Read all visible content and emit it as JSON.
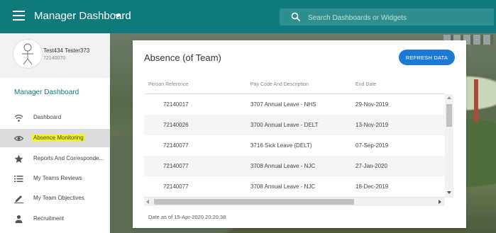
{
  "header": {
    "title": "Manager Dashboard",
    "search_placeholder": "Search Dashboards or Widgets",
    "search_value": ""
  },
  "profile": {
    "name": "Test434 Tester373",
    "id": "72140070"
  },
  "sidebar": {
    "section_title": "Manager Dashboard",
    "items": [
      {
        "label": "Dashboard",
        "icon": "wifi-icon"
      },
      {
        "label": "Absence Monitoring",
        "icon": "eye-icon",
        "active": true
      },
      {
        "label": "Reports And Corresponde...",
        "icon": "star-icon"
      },
      {
        "label": "My Teams Reviews",
        "icon": "list-icon"
      },
      {
        "label": "My Team Objectives",
        "icon": "pencil-icon"
      },
      {
        "label": "Recruitment",
        "icon": "person-icon"
      }
    ]
  },
  "card": {
    "title": "Absence (of Team)",
    "refresh_label": "REFRESH DATA",
    "columns": [
      "Person Reference",
      "Pay Code And Description",
      "End Date"
    ],
    "rows": [
      [
        "72140017",
        "3707 Annual Leave - NHS",
        "29-Nov-2019"
      ],
      [
        "72140026",
        "3700 Annual Leave - DELT",
        "13-Nov-2019"
      ],
      [
        "72140077",
        "3716 Sick Leave (DELT)",
        "07-Sep-2019"
      ],
      [
        "72140077",
        "3708 Annual Leave - NJC",
        "27-Jan-2020"
      ],
      [
        "72140077",
        "3708 Annual Leave - NJC",
        "18-Dec-2019"
      ]
    ],
    "footer": "Date as of 15-Apr-2020 20:20:38"
  },
  "colors": {
    "header": "#0e7a7a",
    "accent_button": "#1a7ad4",
    "highlight": "#f4f423"
  }
}
